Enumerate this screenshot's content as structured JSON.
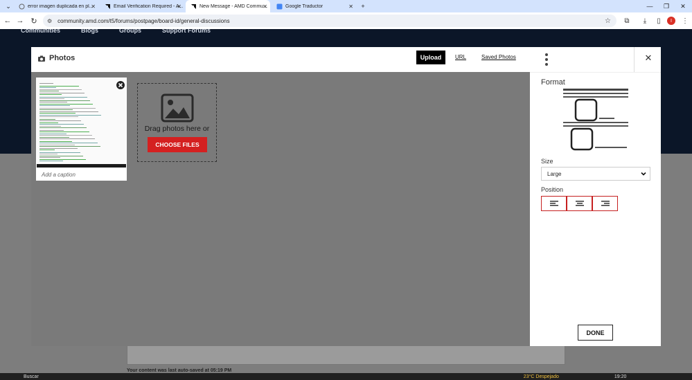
{
  "browser": {
    "tabs": [
      {
        "title": "error imagen duplicada en pl...",
        "active": false,
        "icon": "generic-tab-icon"
      },
      {
        "title": "Email Verification Required - A...",
        "active": false,
        "icon": "amd-logo-icon"
      },
      {
        "title": "New Message - AMD Commu...",
        "active": true,
        "icon": "amd-logo-icon"
      },
      {
        "title": "Google Traductor",
        "active": false,
        "icon": "google-translate-icon"
      }
    ],
    "url": "community.amd.com/t5/forums/postpage/board-id/general-discussions",
    "profile_initial": "I"
  },
  "page": {
    "nav_items": [
      "Communities",
      "Blogs",
      "Groups",
      "Support Forums"
    ],
    "autosave_text": "Your content was last auto-saved at 05:19 PM"
  },
  "taskbar": {
    "search_label": "Buscar",
    "weather": "23°C Despejado",
    "time": "19:20"
  },
  "modal": {
    "title": "Photos",
    "tabs": {
      "upload": "Upload",
      "url": "URL",
      "saved": "Saved Photos"
    },
    "photo": {
      "caption_placeholder": "Add a caption"
    },
    "dropzone": {
      "text": "Drag photos here or",
      "button": "CHOOSE FILES"
    },
    "panel": {
      "format_label": "Format",
      "size_label": "Size",
      "size_value": "Large",
      "position_label": "Position",
      "position_options": [
        "left-align-icon",
        "center-align-icon",
        "right-align-icon"
      ],
      "done": "DONE"
    }
  },
  "colors": {
    "accent_red": "#d42020",
    "overlay_gray": "#7a7a7a",
    "chrome_blue": "#d3e3fd"
  }
}
